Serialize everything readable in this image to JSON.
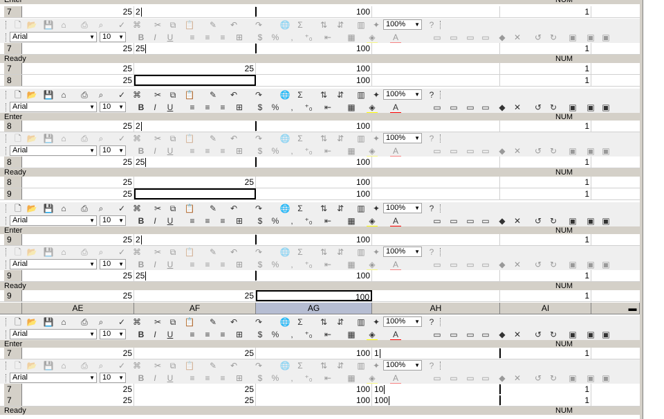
{
  "formatting": {
    "font_name": "Arial",
    "font_size": "10",
    "zoom": "100%"
  },
  "status": {
    "enter": "Enter",
    "ready": "Ready",
    "num": "NUM"
  },
  "columns": [
    "AE",
    "AF",
    "AG",
    "AH",
    "AI"
  ],
  "rows": {
    "r7": "7",
    "r8": "8",
    "r9": "9"
  },
  "values": {
    "v25": "25",
    "v100": "100",
    "v1": "1",
    "edit_2": "2",
    "edit_25": "25",
    "edit_1": "1",
    "edit_10": "10",
    "edit_100": "100"
  },
  "icons": {
    "new": "new-document-icon",
    "open": "open-folder-icon",
    "save": "save-disk-icon",
    "print": "print-icon",
    "spell": "spelling-check-icon",
    "cut": "cut-scissors-icon",
    "copy": "copy-icon",
    "paste": "paste-icon",
    "undo": "undo-icon",
    "redo": "redo-icon",
    "sum": "autosum-icon",
    "chart": "chart-wizard-icon",
    "help": "help-icon"
  }
}
